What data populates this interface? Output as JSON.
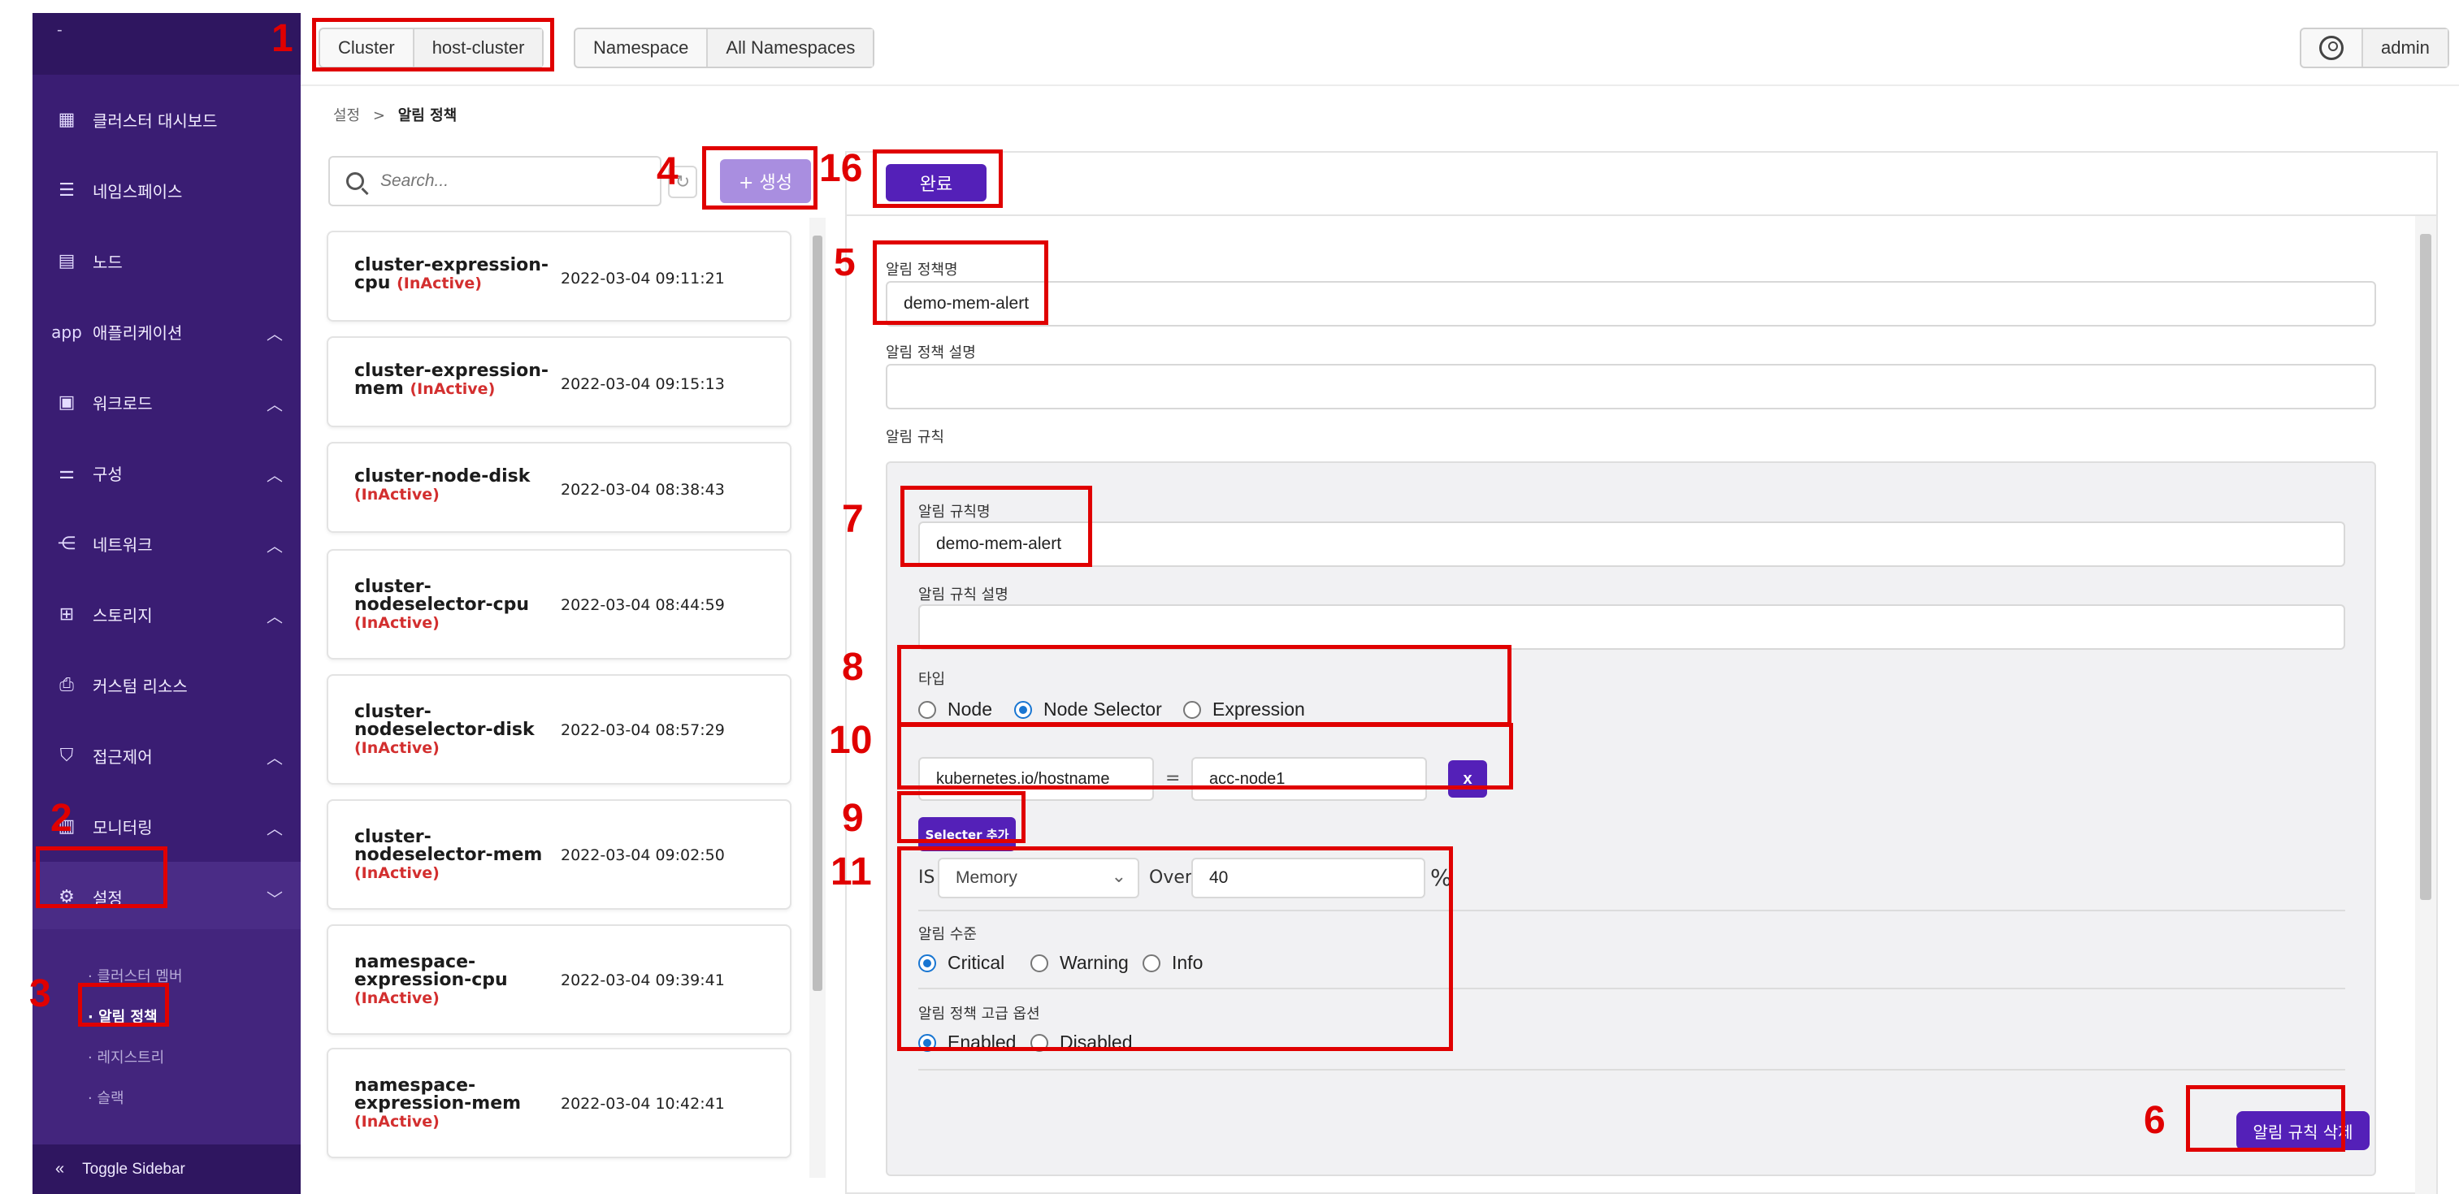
{
  "sidebar": {
    "top_text": "-",
    "items": [
      {
        "label": "클러스터 대시보드",
        "icon": "dashboard-grid-icon",
        "glyph": "▦",
        "chevron": ""
      },
      {
        "label": "네임스페이스",
        "icon": "namespace-icon",
        "glyph": "☰",
        "chevron": ""
      },
      {
        "label": "노드",
        "icon": "node-server-icon",
        "glyph": "▤",
        "chevron": ""
      },
      {
        "label": "애플리케이션",
        "icon": "app-icon",
        "glyph": "app",
        "chevron": "︿"
      },
      {
        "label": "워크로드",
        "icon": "workload-icon",
        "glyph": "▣",
        "chevron": "︿"
      },
      {
        "label": "구성",
        "icon": "config-sliders-icon",
        "glyph": "⚌",
        "chevron": "︿"
      },
      {
        "label": "네트워크",
        "icon": "network-icon",
        "glyph": "⋲",
        "chevron": "︿"
      },
      {
        "label": "스토리지",
        "icon": "storage-icon",
        "glyph": "⊞",
        "chevron": "︿"
      },
      {
        "label": "커스텀 리소스",
        "icon": "custom-resource-icon",
        "glyph": "⎙",
        "chevron": ""
      },
      {
        "label": "접근제어",
        "icon": "shield-check-icon",
        "glyph": "⛉",
        "chevron": "︿"
      },
      {
        "label": "모니터링",
        "icon": "monitoring-icon",
        "glyph": "▥",
        "chevron": "︿"
      },
      {
        "label": "설정",
        "icon": "settings-gear-icon",
        "glyph": "⚙",
        "chevron": "﹀"
      }
    ],
    "sub_items": [
      "· 클러스터 멤버",
      "· 알림 정책",
      "· 레지스트리",
      "· 슬랙"
    ],
    "toggle_label": "Toggle Sidebar",
    "toggle_glyph": "«"
  },
  "topbar": {
    "cluster_label": "Cluster",
    "cluster_value": "host-cluster",
    "namespace_label": "Namespace",
    "namespace_value": "All Namespaces",
    "user_name": "admin"
  },
  "breadcrumb": {
    "parent": "설정",
    "separator": ">",
    "current": "알림 정책"
  },
  "search": {
    "placeholder": "Search..."
  },
  "create_button": "+ 생성",
  "refresh_glyph": "↻",
  "policies": [
    {
      "name": "cluster-expression-cpu",
      "status": "(InActive)",
      "date": "2022-03-04 09:11:21"
    },
    {
      "name": "cluster-expression-mem",
      "status": "(InActive)",
      "date": "2022-03-04 09:15:13"
    },
    {
      "name": "cluster-node-disk",
      "status": "(InActive)",
      "date": "2022-03-04 08:38:43"
    },
    {
      "name": "cluster-nodeselector-cpu",
      "status": "(InActive)",
      "date": "2022-03-04 08:44:59"
    },
    {
      "name": "cluster-nodeselector-disk",
      "status": "(InActive)",
      "date": "2022-03-04 08:57:29"
    },
    {
      "name": "cluster-nodeselector-mem",
      "status": "(InActive)",
      "date": "2022-03-04 09:02:50"
    },
    {
      "name": "namespace-expression-cpu",
      "status": "(InActive)",
      "date": "2022-03-04 09:39:41"
    },
    {
      "name": "namespace-expression-mem",
      "status": "(InActive)",
      "date": "2022-03-04 10:42:41"
    }
  ],
  "detail": {
    "done_button": "완료",
    "policy_name_label": "알림 정책명",
    "policy_name_value": "demo-mem-alert",
    "policy_desc_label": "알림 정책 설명",
    "policy_desc_value": "",
    "rules_label": "알림 규칙",
    "rule_name_label": "알림 규칙명",
    "rule_name_value": "demo-mem-alert",
    "rule_desc_label": "알림 규칙 설명",
    "rule_desc_value": "",
    "type_label": "타입",
    "type_options": [
      "Node",
      "Node Selector",
      "Expression"
    ],
    "type_selected": "Node Selector",
    "selector_key": "kubernetes.io/hostname",
    "selector_eq": "=",
    "selector_value": "acc-node1",
    "selector_remove": "x",
    "add_selector_button": "Selecter 추가",
    "is_label": "IS",
    "metric_value": "Memory",
    "over_label": "Over",
    "threshold_value": "40",
    "unit": "%",
    "level_label": "알림 수준",
    "level_options": [
      "Critical",
      "Warning",
      "Info"
    ],
    "level_selected": "Critical",
    "advanced_label": "알림 정책 고급 옵션",
    "advanced_options": [
      "Enabled",
      "Disabled"
    ],
    "advanced_selected": "Enabled",
    "delete_rule_button": "알림 규칙 삭제"
  },
  "annotations": [
    "1",
    "2",
    "3",
    "4",
    "5",
    "6",
    "7",
    "8",
    "9",
    "10",
    "11",
    "16"
  ],
  "colors": {
    "sidebar": "#3a1d73",
    "accent": "#5420b8",
    "annotation": "#e00000",
    "inactive": "#d32f2f"
  }
}
